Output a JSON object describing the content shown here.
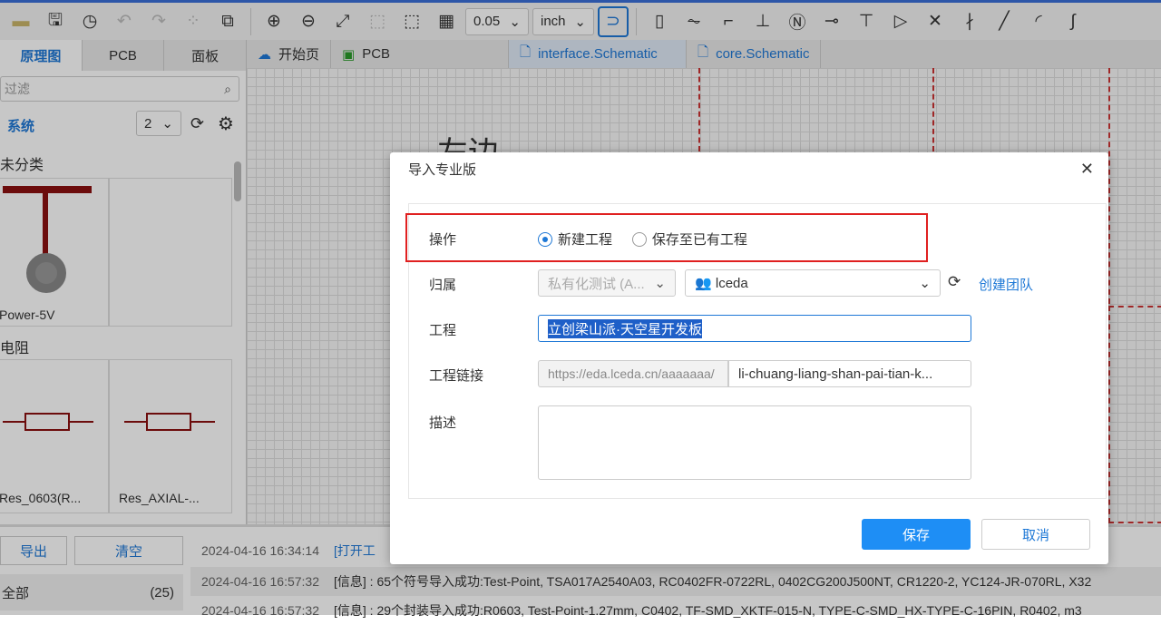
{
  "toolbar": {
    "grid_value": "0.05",
    "unit": "inch"
  },
  "left_tabs": [
    "原理图",
    "PCB",
    "面板"
  ],
  "left": {
    "search_placeholder": "过滤",
    "library": "系统",
    "count": "2",
    "category1": "未分类",
    "item1": "Power-5V",
    "category2": "电阻",
    "item2": "Res_0603(R...",
    "item3": "Res_AXIAL-..."
  },
  "doc_tabs": [
    "开始页",
    "PCB",
    "interface.Schematic",
    "core.Schematic"
  ],
  "canvas": {
    "text": "左边"
  },
  "log": {
    "export": "导出",
    "clear": "清空",
    "filter_all": "全部",
    "filter_count": "(25)",
    "rows": [
      {
        "time": "2024-04-16 16:34:14",
        "msg": "[打开工"
      },
      {
        "time": "2024-04-16 16:57:32",
        "msg": "[信息] : 65个符号导入成功:Test-Point, TSA017A2540A03, RC0402FR-0722RL, 0402CG200J500NT, CR1220-2, YC124-JR-070RL, X32"
      },
      {
        "time": "2024-04-16 16:57:32",
        "msg": "[信息] : 29个封装导入成功:R0603, Test-Point-1.27mm, C0402, TF-SMD_XKTF-015-N, TYPE-C-SMD_HX-TYPE-C-16PIN, R0402, m3"
      }
    ]
  },
  "dialog": {
    "title": "导入专业版",
    "op_label": "操作",
    "op_new": "新建工程",
    "op_existing": "保存至已有工程",
    "owner_label": "归属",
    "owner_value": "私有化测试 (A...",
    "team_value": "lceda",
    "create_team": "创建团队",
    "project_label": "工程",
    "project_value": "立创梁山派·天空星开发板",
    "link_label": "工程链接",
    "link_prefix": "https://eda.lceda.cn/aaaaaaa/",
    "link_value": "li-chuang-liang-shan-pai-tian-k...",
    "desc_label": "描述",
    "save": "保存",
    "cancel": "取消"
  },
  "colors": {
    "accent": "#1e78d6",
    "highlight": "#e02020"
  }
}
